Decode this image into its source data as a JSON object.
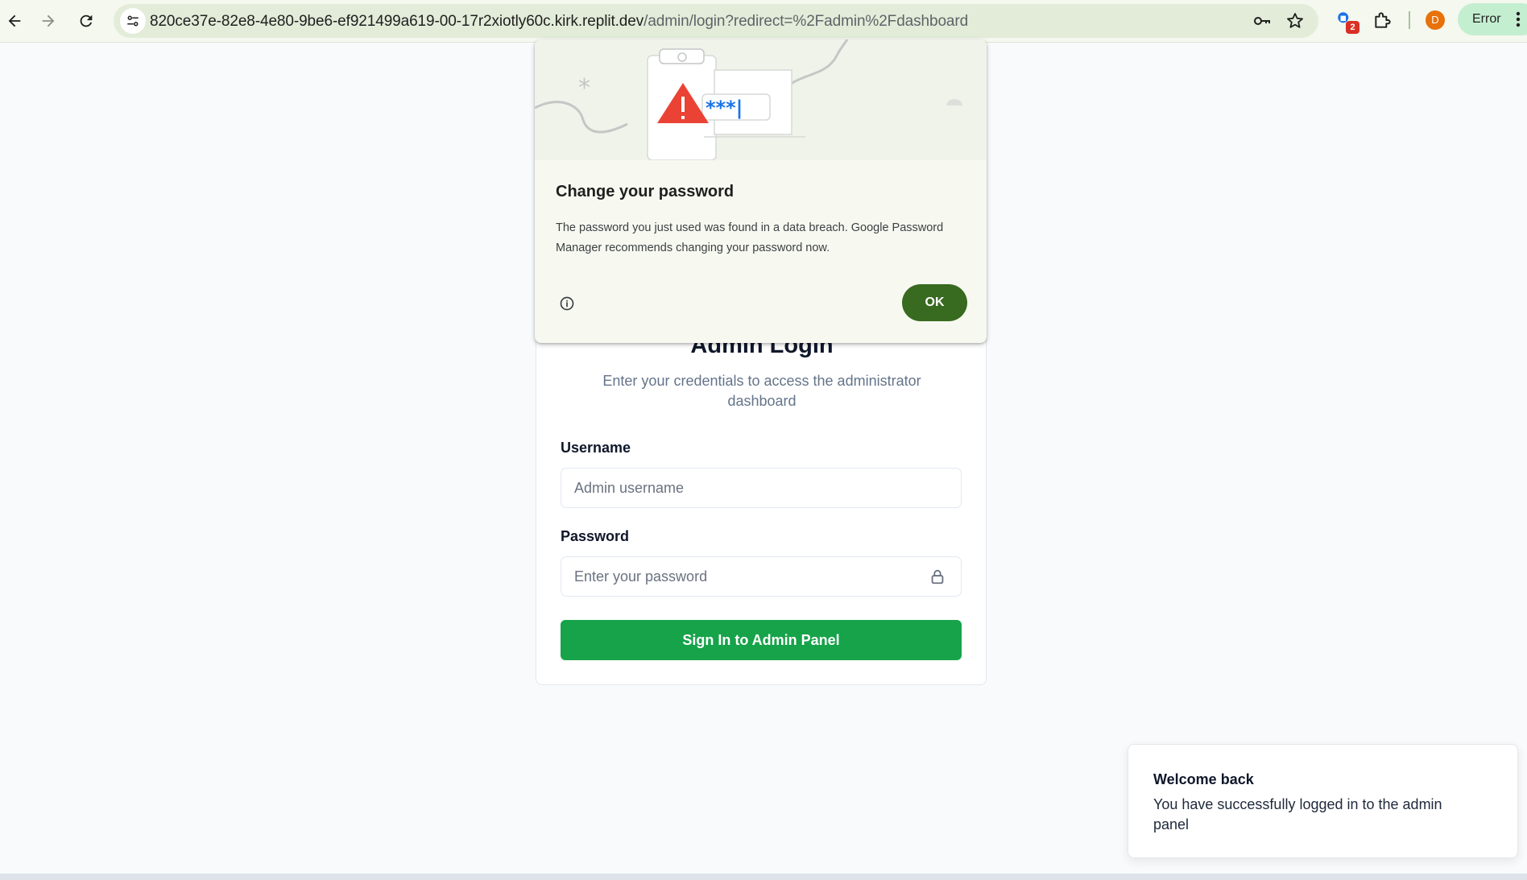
{
  "browser": {
    "url_host": "820ce37e-82e8-4e80-9be6-ef921499a619-00-17r2xiotly60c.kirk.replit.dev",
    "url_path": "/admin/login?redirect=%2Fadmin%2Fdashboard",
    "extension_badge": "2",
    "profile_initial": "D",
    "error_chip": "Error",
    "accent_color": "#386a20"
  },
  "popup": {
    "title": "Change your password",
    "body": "The password you just used was found in a data breach. Google Password Manager recommends changing your password now.",
    "ok_label": "OK",
    "illustration_text": "***|"
  },
  "login": {
    "title": "Admin Login",
    "subtitle": "Enter your credentials to access the administrator dashboard",
    "username_label": "Username",
    "username_placeholder": "Admin username",
    "password_label": "Password",
    "password_placeholder": "Enter your password",
    "submit_label": "Sign In to Admin Panel",
    "submit_color": "#16a34a"
  },
  "toast": {
    "title": "Welcome back",
    "description": "You have successfully logged in to the admin panel"
  }
}
